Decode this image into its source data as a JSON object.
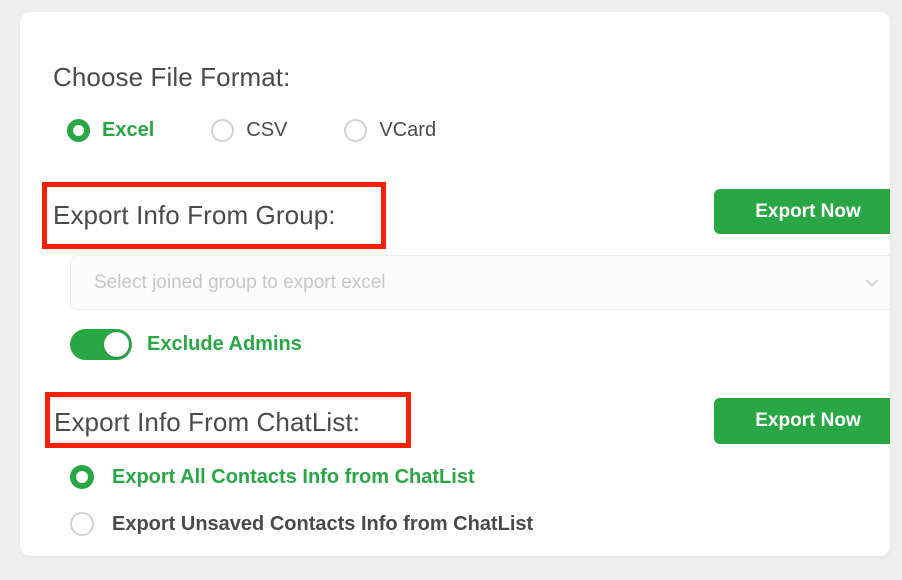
{
  "card": {
    "format_section": {
      "title": "Choose File Format:",
      "options": [
        {
          "label": "Excel",
          "selected": true
        },
        {
          "label": "CSV",
          "selected": false
        },
        {
          "label": "VCard",
          "selected": false
        }
      ]
    },
    "group_section": {
      "title": "Export Info From Group:",
      "export_button": "Export Now",
      "select_placeholder": "Select joined group to export excel",
      "select_value": "",
      "chevron_icon": "chevron-down-icon",
      "toggle": {
        "label": "Exclude Admins",
        "on": true
      }
    },
    "chatlist_section": {
      "title": "Export Info From ChatList:",
      "export_button": "Export Now",
      "options": [
        {
          "label": "Export All Contacts Info from ChatList",
          "selected": true
        },
        {
          "label": "Export Unsaved Contacts Info from ChatList",
          "selected": false
        }
      ]
    }
  },
  "colors": {
    "accent_green": "#2aa745",
    "annotation_red": "#f81f07",
    "text_gray": "#4a4a4a",
    "placeholder_gray": "#c6c6c6",
    "card_background": "#ffffff",
    "page_background": "#efefef"
  }
}
